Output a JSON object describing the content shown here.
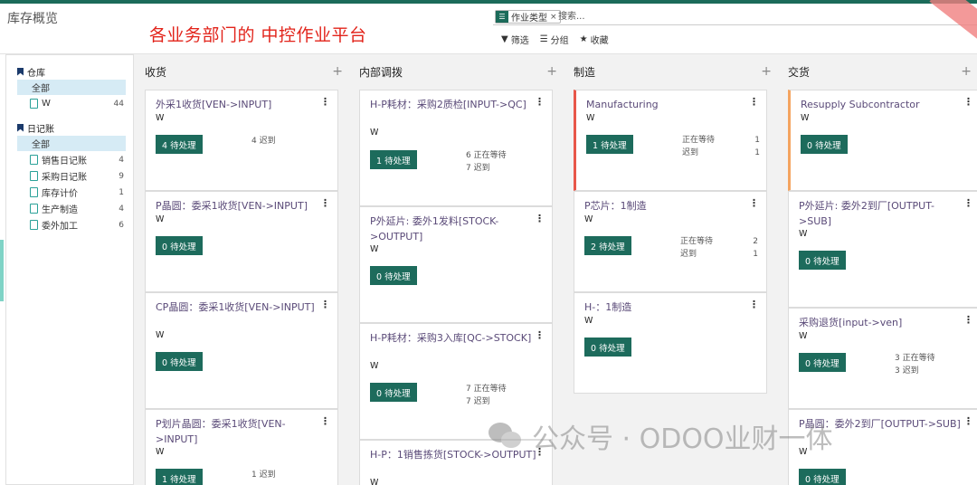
{
  "header": {
    "breadcrumb": "库存概览",
    "banner": "各业务部门的 中控作业平台",
    "search": {
      "facet_label": "作业类型",
      "facet_close": "×",
      "placeholder": "搜索..."
    },
    "toolbar": {
      "filter": "筛选",
      "group": "分组",
      "favorite": "收藏"
    }
  },
  "sidebar": {
    "warehouse": {
      "title": "仓库",
      "items": [
        {
          "label": "全部",
          "count": ""
        },
        {
          "label": "W",
          "count": "44"
        }
      ]
    },
    "journal": {
      "title": "日记账",
      "items": [
        {
          "label": "全部",
          "count": ""
        },
        {
          "label": "销售日记账",
          "count": "4"
        },
        {
          "label": "采购日记账",
          "count": "9"
        },
        {
          "label": "库存计价",
          "count": "1"
        },
        {
          "label": "生产制造",
          "count": "4"
        },
        {
          "label": "委外加工",
          "count": "6"
        }
      ]
    }
  },
  "columns": [
    {
      "title": "收货",
      "cards": [
        {
          "title": "外采1收货[VEN->INPUT]",
          "wh": "W",
          "button": "4 待处理",
          "stats": [
            {
              "label": "4 迟到",
              "value": ""
            }
          ]
        },
        {
          "title": "P晶圆：委采1收货[VEN->INPUT]",
          "wh": "W",
          "button": "0 待处理",
          "stats": []
        },
        {
          "title": "CP晶圆：委采1收货[VEN->INPUT]",
          "wh": "W",
          "button": "0 待处理",
          "stats": []
        },
        {
          "title": "P划片晶圆：委采1收货[VEN->INPUT]",
          "wh": "W",
          "button": "1 待处理",
          "stats": [
            {
              "label": "1 迟到",
              "value": ""
            }
          ]
        }
      ]
    },
    {
      "title": "内部调拨",
      "cards": [
        {
          "title": "H-P耗材：采购2质检[INPUT->QC]",
          "wh": "W",
          "button": "1 待处理",
          "stats": [
            {
              "label": "6 正在等待",
              "value": ""
            },
            {
              "label": "7 迟到",
              "value": ""
            }
          ]
        },
        {
          "title": "P外延片: 委外1发料[STOCK->OUTPUT]",
          "wh": "W",
          "button": "0 待处理",
          "stats": []
        },
        {
          "title": "H-P耗材：采购3入库[QC->STOCK]",
          "wh": "W",
          "button": "0 待处理",
          "stats": [
            {
              "label": "7 正在等待",
              "value": ""
            },
            {
              "label": "7 迟到",
              "value": ""
            }
          ]
        },
        {
          "title": "H-P：1销售拣货[STOCK->OUTPUT]",
          "wh": "W",
          "button": "",
          "stats": []
        }
      ]
    },
    {
      "title": "制造",
      "cards": [
        {
          "title": "Manufacturing",
          "wh": "W",
          "button": "1 待处理",
          "stats": [
            {
              "label": "正在等待",
              "value": "1"
            },
            {
              "label": "迟到",
              "value": "1"
            }
          ]
        },
        {
          "title": "P芯片：1制造",
          "wh": "W",
          "button": "2 待处理",
          "stats": [
            {
              "label": "正在等待",
              "value": "2"
            },
            {
              "label": "迟到",
              "value": "1"
            }
          ]
        },
        {
          "title": "H-：1制造",
          "wh": "W",
          "button": "0 待处理",
          "stats": []
        }
      ]
    },
    {
      "title": "交货",
      "cards": [
        {
          "title": "Resupply Subcontractor",
          "wh": "W",
          "button": "0 待处理",
          "stats": []
        },
        {
          "title": "P外延片: 委外2到厂[OUTPUT->SUB]",
          "wh": "W",
          "button": "0 待处理",
          "stats": []
        },
        {
          "title": "采购退货[input->ven]",
          "wh": "W",
          "button": "0 待处理",
          "stats": [
            {
              "label": "3 正在等待",
              "value": ""
            },
            {
              "label": "3 迟到",
              "value": ""
            }
          ]
        },
        {
          "title": "P晶圆：委外2到厂[OUTPUT->SUB]",
          "wh": "W",
          "button": "0 待处理",
          "stats": []
        }
      ]
    }
  ],
  "watermark": "公众号 · ODOO业财一体",
  "colors": {
    "primary": "#1d6b5c",
    "banner": "#e2231a",
    "manufacturing_accent": "#e8574a",
    "resupply_accent": "#f4a460"
  }
}
